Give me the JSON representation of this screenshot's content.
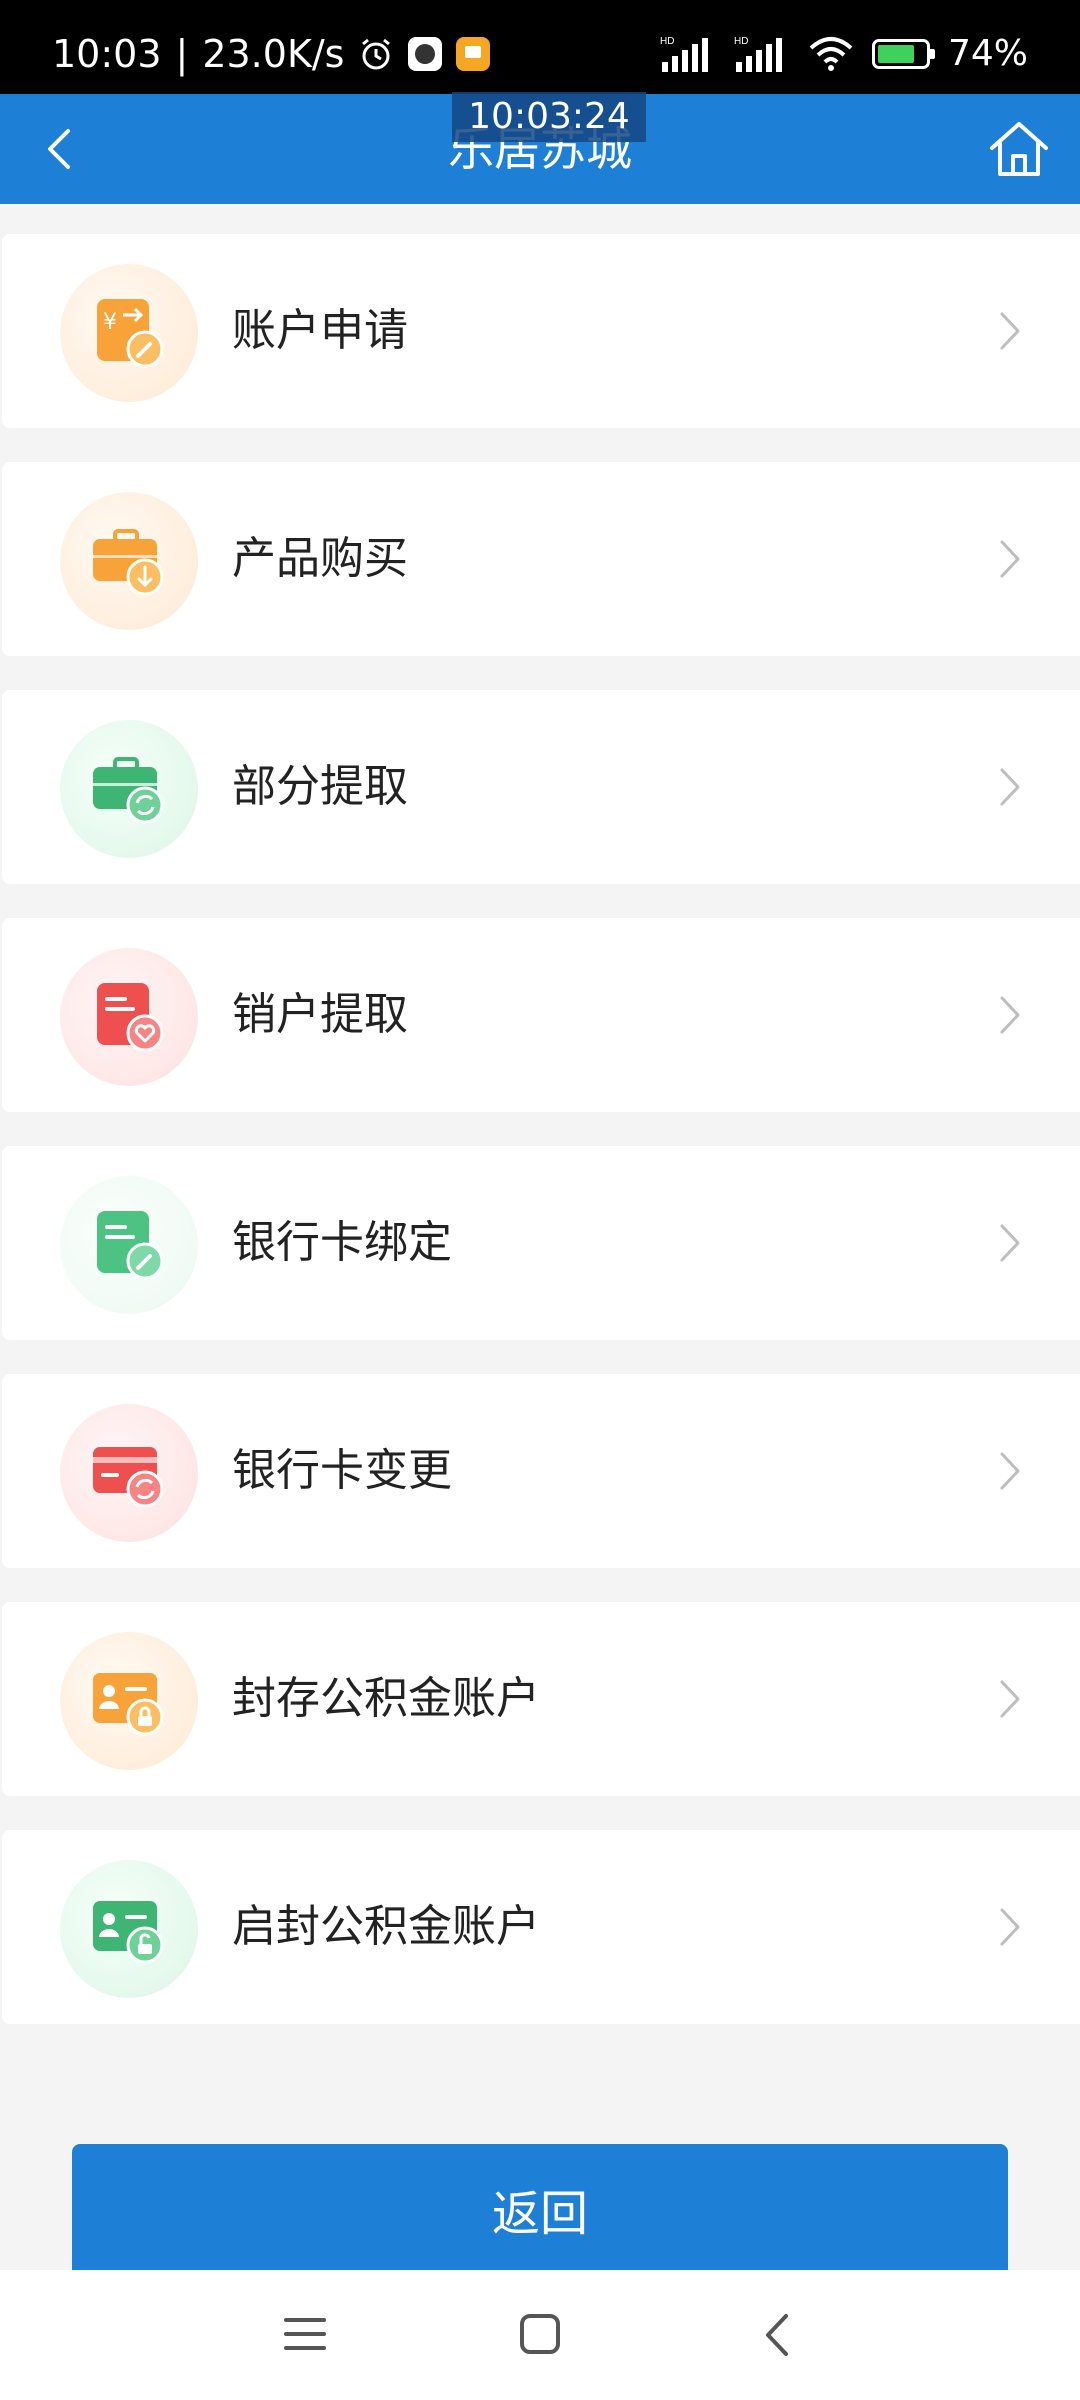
{
  "status_bar": {
    "time": "10:03",
    "speed": "23.0K/s",
    "battery_percent": "74%",
    "signal_label_1": "HD",
    "signal_label_2": "HD"
  },
  "header": {
    "title": "乐居苏城",
    "time_overlay": "10:03:24"
  },
  "menu": {
    "items": [
      {
        "label": "账户申请",
        "icon": "account-apply-icon",
        "color": "#f7a33a"
      },
      {
        "label": "产品购买",
        "icon": "product-purchase-icon",
        "color": "#f7a33a"
      },
      {
        "label": "部分提取",
        "icon": "partial-withdraw-icon",
        "color": "#3fb574"
      },
      {
        "label": "销户提取",
        "icon": "close-account-withdraw-icon",
        "color": "#ee5050"
      },
      {
        "label": "银行卡绑定",
        "icon": "bank-card-bind-icon",
        "color": "#4cc283"
      },
      {
        "label": "银行卡变更",
        "icon": "bank-card-change-icon",
        "color": "#ee5050"
      },
      {
        "label": "封存公积金账户",
        "icon": "seal-fund-account-icon",
        "color": "#f7a33a"
      },
      {
        "label": "启封公积金账户",
        "icon": "unseal-fund-account-icon",
        "color": "#3fb574"
      }
    ]
  },
  "actions": {
    "return_label": "返回"
  },
  "colors": {
    "primary": "#1e7fd6",
    "background": "#f4f4f4"
  }
}
